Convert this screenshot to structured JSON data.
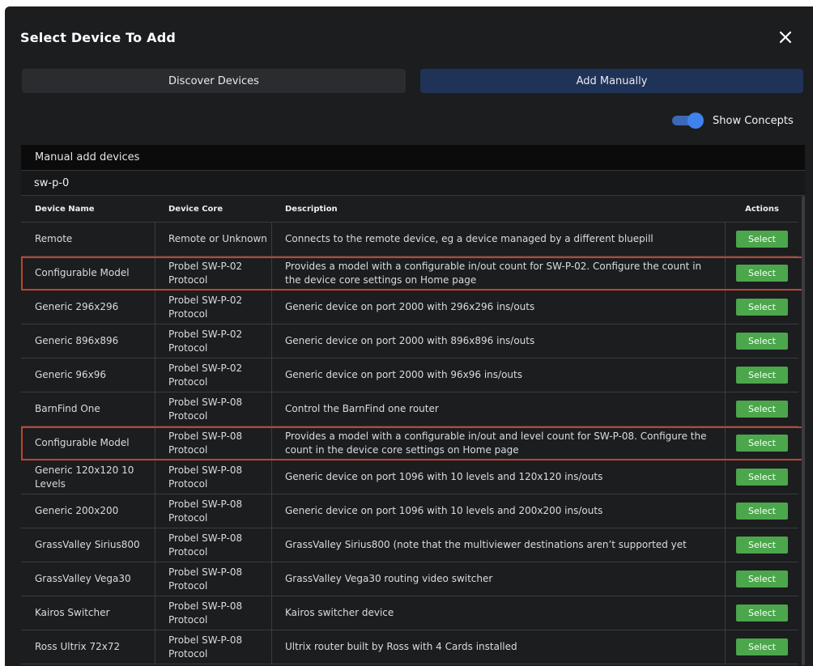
{
  "dialog": {
    "title": "Select Device To Add"
  },
  "tabs": {
    "discover": "Discover Devices",
    "manual": "Add Manually"
  },
  "toggle": {
    "label": "Show Concepts",
    "on": true
  },
  "panel": {
    "header": "Manual add devices",
    "search_value": "sw-p-0"
  },
  "table": {
    "headers": {
      "name": "Device Name",
      "core": "Device Core",
      "description": "Description",
      "actions": "Actions"
    },
    "select_label": "Select",
    "rows": [
      {
        "name": "Remote",
        "core": "Remote or Unknown",
        "description": "Connects to the remote device, eg a device managed by a different bluepill",
        "highlighted": false
      },
      {
        "name": "Configurable Model",
        "core": "Probel SW-P-02 Protocol",
        "description": "Provides a model with a configurable in/out count for SW-P-02. Configure the count in the device core settings on Home page",
        "highlighted": true
      },
      {
        "name": "Generic 296x296",
        "core": "Probel SW-P-02 Protocol",
        "description": "Generic device on port 2000 with 296x296 ins/outs",
        "highlighted": false
      },
      {
        "name": "Generic 896x896",
        "core": "Probel SW-P-02 Protocol",
        "description": "Generic device on port 2000 with 896x896 ins/outs",
        "highlighted": false
      },
      {
        "name": "Generic 96x96",
        "core": "Probel SW-P-02 Protocol",
        "description": "Generic device on port 2000 with 96x96 ins/outs",
        "highlighted": false
      },
      {
        "name": "BarnFind One",
        "core": "Probel SW-P-08 Protocol",
        "description": "Control the BarnFind one router",
        "highlighted": false
      },
      {
        "name": "Configurable Model",
        "core": "Probel SW-P-08 Protocol",
        "description": "Provides a model with a configurable in/out and level count for SW-P-08. Configure the count in the device core settings on Home page",
        "highlighted": true
      },
      {
        "name": "Generic 120x120 10 Levels",
        "core": "Probel SW-P-08 Protocol",
        "description": "Generic device on port 1096 with 10 levels and 120x120 ins/outs",
        "highlighted": false
      },
      {
        "name": "Generic 200x200",
        "core": "Probel SW-P-08 Protocol",
        "description": "Generic device on port 1096 with 10 levels and 200x200 ins/outs",
        "highlighted": false
      },
      {
        "name": "GrassValley Sirius800",
        "core": "Probel SW-P-08 Protocol",
        "description": "GrassValley Sirius800 (note that the multiviewer destinations aren’t supported yet",
        "highlighted": false
      },
      {
        "name": "GrassValley Vega30",
        "core": "Probel SW-P-08 Protocol",
        "description": "GrassValley Vega30 routing video switcher",
        "highlighted": false
      },
      {
        "name": "Kairos Switcher",
        "core": "Probel SW-P-08 Protocol",
        "description": "Kairos switcher device",
        "highlighted": false
      },
      {
        "name": "Ross Ultrix 72x72",
        "core": "Probel SW-P-08 Protocol",
        "description": "Ultrix router built by Ross with 4 Cards installed",
        "highlighted": false
      }
    ]
  },
  "colors": {
    "background": "#1c1d1f",
    "tab_active": "#1f3258",
    "select_button": "#4ca64c",
    "highlight": "#c0432e",
    "toggle": "#3f82ee"
  }
}
